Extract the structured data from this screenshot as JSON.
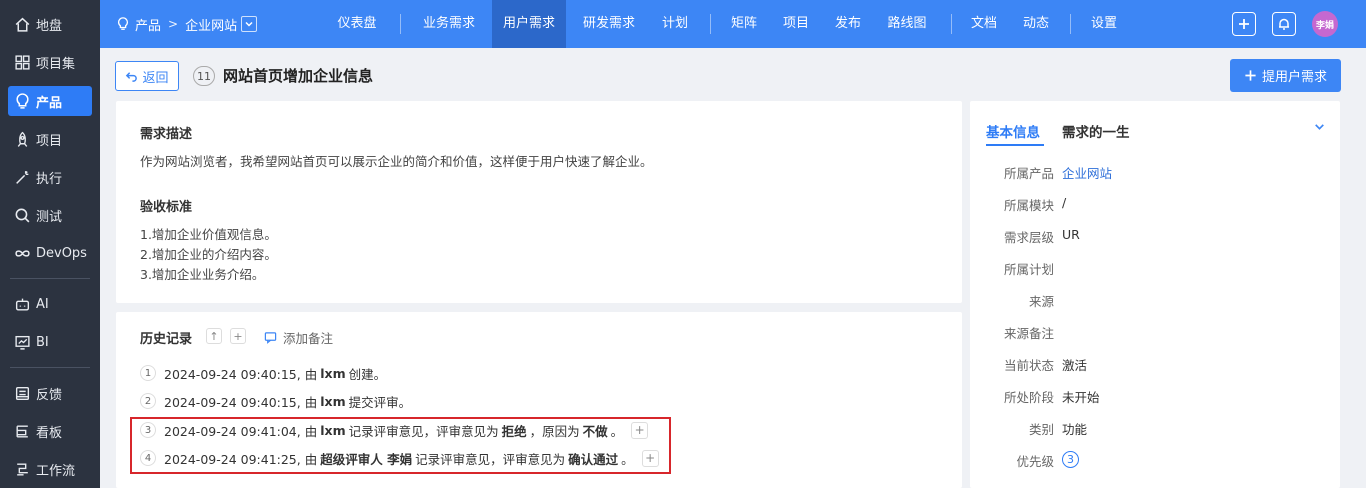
{
  "sidebar": {
    "items": [
      {
        "label": "地盘",
        "icon": "home-icon"
      },
      {
        "label": "项目集",
        "icon": "grid-icon"
      },
      {
        "label": "产品",
        "icon": "lightbulb-icon"
      },
      {
        "label": "项目",
        "icon": "rocket-icon"
      },
      {
        "label": "执行",
        "icon": "wand-icon"
      },
      {
        "label": "测试",
        "icon": "search-icon"
      },
      {
        "label": "DevOps",
        "icon": "infinity-icon"
      },
      {
        "label": "AI",
        "icon": "robot-icon"
      },
      {
        "label": "BI",
        "icon": "chart-icon"
      },
      {
        "label": "反馈",
        "icon": "feedback-icon"
      },
      {
        "label": "看板",
        "icon": "kanban-icon"
      },
      {
        "label": "工作流",
        "icon": "workflow-icon"
      }
    ]
  },
  "header": {
    "breadcrumb": {
      "root": "产品",
      "current": "企业网站"
    },
    "nav": [
      "仪表盘",
      "业务需求",
      "用户需求",
      "研发需求",
      "计划",
      "矩阵",
      "项目",
      "发布",
      "路线图",
      "文档",
      "动态",
      "设置"
    ],
    "active_nav": "用户需求",
    "avatar": "李娟"
  },
  "titlebar": {
    "back": "返回",
    "id": "11",
    "title": "网站首页增加企业信息",
    "create": "提用户需求"
  },
  "desc": {
    "title": "需求描述",
    "text": "作为网站浏览者，我希望网站首页可以展示企业的简介和价值，这样便于用户快速了解企业。"
  },
  "acceptance": {
    "title": "验收标准",
    "lines": [
      "1.增加企业价值观信息。",
      "2.增加企业的介绍内容。",
      "3.增加企业业务介绍。"
    ]
  },
  "history": {
    "title": "历史记录",
    "add_note": "添加备注",
    "rows": [
      {
        "num": "1",
        "time": "2024-09-24 09:40:15, 由",
        "actor": "lxm",
        "rest": "创建。"
      },
      {
        "num": "2",
        "time": "2024-09-24 09:40:15, 由",
        "actor": "lxm",
        "rest": "提交评审。"
      },
      {
        "num": "3",
        "time": "2024-09-24 09:41:04, 由",
        "actor": "lxm",
        "rest": "记录评审意见，评审意见为",
        "bold1": "拒绝",
        "mid": "，原因为",
        "bold2": "不做",
        "end": "。"
      },
      {
        "num": "4",
        "time": "2024-09-24 09:41:25, 由",
        "actor": "超级评审人 李娟",
        "rest": "记录评审意见，评审意见为",
        "bold1": "确认通过",
        "end": "。"
      }
    ]
  },
  "info": {
    "tab1": "基本信息",
    "tab2": "需求的一生",
    "fields": [
      {
        "label": "所属产品",
        "value": "企业网站",
        "link": true
      },
      {
        "label": "所属模块",
        "value": "/"
      },
      {
        "label": "需求层级",
        "value": "UR"
      },
      {
        "label": "所属计划",
        "value": ""
      },
      {
        "label": "来源",
        "value": ""
      },
      {
        "label": "来源备注",
        "value": ""
      },
      {
        "label": "当前状态",
        "value": "激活"
      },
      {
        "label": "所处阶段",
        "value": "未开始"
      },
      {
        "label": "类别",
        "value": "功能"
      },
      {
        "label": "优先级",
        "value": "3"
      }
    ]
  },
  "colors": {
    "primary": "#3d86f5",
    "sidebar": "#2c3340",
    "highlight": "#d7262b"
  }
}
